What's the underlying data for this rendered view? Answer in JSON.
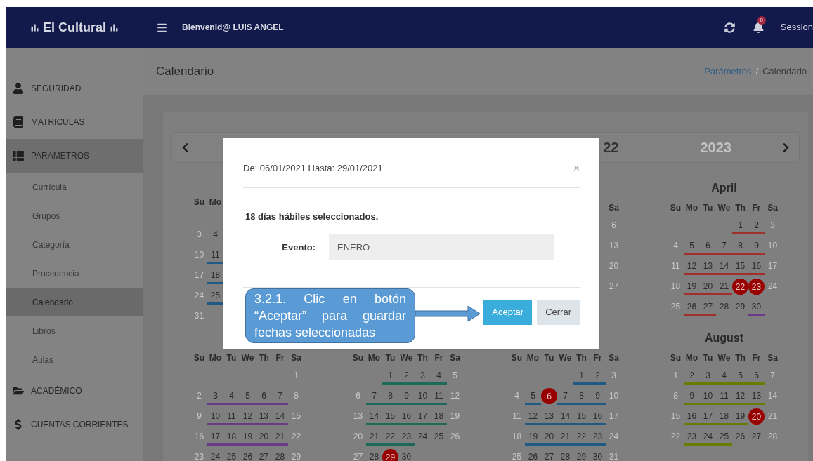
{
  "header": {
    "brand": "El Cultural",
    "welcome": "Bienvenid@ LUIS ANGEL",
    "notifications": "0",
    "session": "Session"
  },
  "sidebar": {
    "items": [
      {
        "label": "SEGURIDAD",
        "selected": false,
        "expanded": false
      },
      {
        "label": "MATRICULAS",
        "selected": false,
        "expanded": false
      },
      {
        "label": "PARAMETROS",
        "selected": false,
        "expanded": true,
        "children": [
          {
            "label": "Currícula",
            "selected": false
          },
          {
            "label": "Grupos",
            "selected": false
          },
          {
            "label": "Categoría",
            "selected": false
          },
          {
            "label": "Procedencia",
            "selected": false
          },
          {
            "label": "Calendario",
            "selected": true
          },
          {
            "label": "Libros",
            "selected": false
          },
          {
            "label": "Aulas",
            "selected": false
          }
        ]
      },
      {
        "label": "ACADÉMICO",
        "selected": false,
        "expanded": false
      },
      {
        "label": "CUENTAS CORRIENTES",
        "selected": false,
        "expanded": false
      }
    ]
  },
  "page": {
    "title": "Calendario",
    "separator": "/",
    "breadcrumb": [
      {
        "label": "Parámetros",
        "kind": "link"
      },
      {
        "label": "Calendario",
        "kind": "current"
      }
    ]
  },
  "calendar": {
    "years": [
      {
        "label": "22",
        "selected": true
      },
      {
        "label": "2023",
        "selected": false
      }
    ],
    "months": [
      {
        "kind": "left",
        "weekdays": [
          "Su",
          "Mo"
        ],
        "weeks": [
          {
            "kind": "covered"
          },
          {
            "kind": "days",
            "days": [
              {
                "d": "3",
                "kind": "plain"
              },
              {
                "d": "4",
                "kind": "plain"
              }
            ]
          },
          {
            "kind": "days",
            "days": [
              {
                "d": "10",
                "kind": "plain"
              },
              {
                "d": "11",
                "kind": "event",
                "color": "#1f5a85"
              }
            ]
          },
          {
            "kind": "days",
            "days": [
              {
                "d": "17",
                "kind": "plain"
              },
              {
                "d": "18",
                "kind": "event",
                "color": "#1f5a85"
              }
            ]
          },
          {
            "kind": "days",
            "days": [
              {
                "d": "24",
                "kind": "plain"
              },
              {
                "d": "25",
                "kind": "event",
                "color": "#1f5a85"
              }
            ]
          },
          {
            "kind": "days",
            "days": [
              {
                "d": "31",
                "kind": "plain"
              }
            ]
          }
        ]
      },
      {
        "kind": "covered"
      },
      {
        "kind": "right",
        "weekdays": [
          "Sa"
        ],
        "weeks": [
          {
            "kind": "days",
            "days": [
              {
                "d": "6",
                "kind": "plain"
              }
            ]
          },
          {
            "kind": "days",
            "days": [
              {
                "d": "13",
                "kind": "plain"
              }
            ]
          },
          {
            "kind": "days",
            "days": [
              {
                "d": "20",
                "kind": "plain"
              }
            ]
          },
          {
            "kind": "days",
            "days": [
              {
                "d": "27",
                "kind": "plain"
              }
            ]
          }
        ]
      },
      {
        "kind": "full",
        "title": "April",
        "weekdays": [
          "Su",
          "Mo",
          "Tu",
          "We",
          "Th",
          "Fr",
          "Sa"
        ],
        "weeks": [
          {
            "kind": "days",
            "days": [
              {
                "d": "1",
                "kind": "event",
                "color": "#a0302a"
              },
              {
                "d": "2",
                "kind": "event",
                "color": "#a0302a"
              },
              {
                "d": "3",
                "kind": "plain"
              }
            ]
          },
          {
            "kind": "days",
            "days": [
              {
                "d": "4",
                "kind": "plain"
              },
              {
                "d": "5",
                "kind": "event",
                "color": "#a0302a"
              },
              {
                "d": "6",
                "kind": "event",
                "color": "#a0302a"
              },
              {
                "d": "7",
                "kind": "event",
                "color": "#a0302a"
              },
              {
                "d": "8",
                "kind": "event",
                "color": "#a0302a"
              },
              {
                "d": "9",
                "kind": "event",
                "color": "#a0302a"
              },
              {
                "d": "10",
                "kind": "plain"
              }
            ]
          },
          {
            "kind": "days",
            "days": [
              {
                "d": "11",
                "kind": "plain"
              },
              {
                "d": "12",
                "kind": "event",
                "color": "#a0302a"
              },
              {
                "d": "13",
                "kind": "event",
                "color": "#a0302a"
              },
              {
                "d": "14",
                "kind": "event",
                "color": "#a0302a"
              },
              {
                "d": "15",
                "kind": "event",
                "color": "#a0302a"
              },
              {
                "d": "16",
                "kind": "event",
                "color": "#a0302a"
              },
              {
                "d": "17",
                "kind": "plain"
              }
            ]
          },
          {
            "kind": "days",
            "days": [
              {
                "d": "18",
                "kind": "plain"
              },
              {
                "d": "19",
                "kind": "event",
                "color": "#a0302a"
              },
              {
                "d": "20",
                "kind": "event",
                "color": "#a0302a"
              },
              {
                "d": "21",
                "kind": "event",
                "color": "#a0302a"
              },
              {
                "d": "22",
                "kind": "holiday"
              },
              {
                "d": "23",
                "kind": "holiday"
              },
              {
                "d": "24",
                "kind": "plain"
              }
            ]
          },
          {
            "kind": "days",
            "days": [
              {
                "d": "25",
                "kind": "plain"
              },
              {
                "d": "26",
                "kind": "event",
                "color": "#a0302a"
              },
              {
                "d": "27",
                "kind": "event",
                "color": "#a0302a"
              },
              {
                "d": "28",
                "kind": "plain"
              },
              {
                "d": "29",
                "kind": "plain"
              },
              {
                "d": "30",
                "kind": "event",
                "color": "#6a3a8a"
              }
            ]
          }
        ]
      },
      {
        "kind": "full",
        "weekdays": [
          "Su",
          "Mo",
          "Tu",
          "We",
          "Th",
          "Fr",
          "Sa"
        ],
        "weeks": [
          {
            "kind": "days",
            "days": [
              {
                "d": "1",
                "kind": "plain"
              }
            ]
          },
          {
            "kind": "days",
            "days": [
              {
                "d": "2",
                "kind": "plain"
              },
              {
                "d": "3",
                "kind": "event",
                "color": "#6a3a8a"
              },
              {
                "d": "4",
                "kind": "event",
                "color": "#6a3a8a"
              },
              {
                "d": "5",
                "kind": "event",
                "color": "#6a3a8a"
              },
              {
                "d": "6",
                "kind": "event",
                "color": "#6a3a8a"
              },
              {
                "d": "7",
                "kind": "event",
                "color": "#6a3a8a"
              },
              {
                "d": "8",
                "kind": "plain"
              }
            ]
          },
          {
            "kind": "days",
            "days": [
              {
                "d": "9",
                "kind": "plain"
              },
              {
                "d": "10",
                "kind": "event",
                "color": "#6a3a8a"
              },
              {
                "d": "11",
                "kind": "event",
                "color": "#6a3a8a"
              },
              {
                "d": "12",
                "kind": "event",
                "color": "#6a3a8a"
              },
              {
                "d": "13",
                "kind": "event",
                "color": "#6a3a8a"
              },
              {
                "d": "14",
                "kind": "event",
                "color": "#6a3a8a"
              },
              {
                "d": "15",
                "kind": "plain"
              }
            ]
          },
          {
            "kind": "days",
            "days": [
              {
                "d": "16",
                "kind": "plain"
              },
              {
                "d": "17",
                "kind": "event",
                "color": "#6a3a8a"
              },
              {
                "d": "18",
                "kind": "event",
                "color": "#6a3a8a"
              },
              {
                "d": "19",
                "kind": "event",
                "color": "#6a3a8a"
              },
              {
                "d": "20",
                "kind": "event",
                "color": "#6a3a8a"
              },
              {
                "d": "21",
                "kind": "event",
                "color": "#6a3a8a"
              },
              {
                "d": "22",
                "kind": "plain"
              }
            ]
          },
          {
            "kind": "days",
            "days": [
              {
                "d": "23",
                "kind": "plain"
              },
              {
                "d": "24",
                "kind": "plain"
              },
              {
                "d": "25",
                "kind": "plain"
              },
              {
                "d": "26",
                "kind": "plain"
              },
              {
                "d": "27",
                "kind": "plain"
              },
              {
                "d": "28",
                "kind": "plain"
              },
              {
                "d": "29",
                "kind": "plain"
              }
            ]
          }
        ]
      },
      {
        "kind": "full",
        "weekdays": [
          "Su",
          "Mo",
          "Tu",
          "We",
          "Th",
          "Fr",
          "Sa"
        ],
        "weeks": [
          {
            "kind": "days",
            "days": [
              {
                "d": "1",
                "kind": "event",
                "color": "#1e6a5a"
              },
              {
                "d": "2",
                "kind": "event",
                "color": "#1e6a5a"
              },
              {
                "d": "3",
                "kind": "event",
                "color": "#1e6a5a"
              },
              {
                "d": "4",
                "kind": "event",
                "color": "#1e6a5a"
              },
              {
                "d": "5",
                "kind": "plain"
              }
            ]
          },
          {
            "kind": "days",
            "days": [
              {
                "d": "6",
                "kind": "plain"
              },
              {
                "d": "7",
                "kind": "event",
                "color": "#1e6a5a"
              },
              {
                "d": "8",
                "kind": "event",
                "color": "#1e6a5a"
              },
              {
                "d": "9",
                "kind": "event",
                "color": "#1e6a5a"
              },
              {
                "d": "10",
                "kind": "event",
                "color": "#1e6a5a"
              },
              {
                "d": "11",
                "kind": "event",
                "color": "#1e6a5a"
              },
              {
                "d": "12",
                "kind": "plain"
              }
            ]
          },
          {
            "kind": "days",
            "days": [
              {
                "d": "13",
                "kind": "plain"
              },
              {
                "d": "14",
                "kind": "event",
                "color": "#1e6a5a"
              },
              {
                "d": "15",
                "kind": "event",
                "color": "#1e6a5a"
              },
              {
                "d": "16",
                "kind": "event",
                "color": "#1e6a5a"
              },
              {
                "d": "17",
                "kind": "event",
                "color": "#1e6a5a"
              },
              {
                "d": "18",
                "kind": "event",
                "color": "#1e6a5a"
              },
              {
                "d": "19",
                "kind": "plain"
              }
            ]
          },
          {
            "kind": "days",
            "days": [
              {
                "d": "20",
                "kind": "plain"
              },
              {
                "d": "21",
                "kind": "event",
                "color": "#1e6a5a"
              },
              {
                "d": "22",
                "kind": "event",
                "color": "#1e6a5a"
              },
              {
                "d": "23",
                "kind": "event",
                "color": "#1e6a5a"
              },
              {
                "d": "24",
                "kind": "plain"
              },
              {
                "d": "25",
                "kind": "plain"
              },
              {
                "d": "26",
                "kind": "plain"
              }
            ]
          },
          {
            "kind": "days",
            "days": [
              {
                "d": "27",
                "kind": "plain"
              },
              {
                "d": "28",
                "kind": "plain"
              },
              {
                "d": "29",
                "kind": "holiday"
              },
              {
                "d": "30",
                "kind": "plain"
              }
            ]
          }
        ]
      },
      {
        "kind": "full",
        "weekdays": [
          "Su",
          "Mo",
          "Tu",
          "We",
          "Th",
          "Fr",
          "Sa"
        ],
        "weeks": [
          {
            "kind": "days",
            "days": [
              {
                "d": "1",
                "kind": "event",
                "color": "#1f5a85"
              },
              {
                "d": "2",
                "kind": "event",
                "color": "#1f5a85"
              },
              {
                "d": "3",
                "kind": "plain"
              }
            ]
          },
          {
            "kind": "days",
            "days": [
              {
                "d": "4",
                "kind": "plain"
              },
              {
                "d": "5",
                "kind": "event",
                "color": "#1f5a85"
              },
              {
                "d": "6",
                "kind": "holiday"
              },
              {
                "d": "7",
                "kind": "event",
                "color": "#1f5a85"
              },
              {
                "d": "8",
                "kind": "event",
                "color": "#1f5a85"
              },
              {
                "d": "9",
                "kind": "event",
                "color": "#1f5a85"
              },
              {
                "d": "10",
                "kind": "plain"
              }
            ]
          },
          {
            "kind": "days",
            "days": [
              {
                "d": "11",
                "kind": "plain"
              },
              {
                "d": "12",
                "kind": "event",
                "color": "#1f5a85"
              },
              {
                "d": "13",
                "kind": "event",
                "color": "#1f5a85"
              },
              {
                "d": "14",
                "kind": "event",
                "color": "#1f5a85"
              },
              {
                "d": "15",
                "kind": "event",
                "color": "#1f5a85"
              },
              {
                "d": "16",
                "kind": "event",
                "color": "#1f5a85"
              },
              {
                "d": "17",
                "kind": "plain"
              }
            ]
          },
          {
            "kind": "days",
            "days": [
              {
                "d": "18",
                "kind": "plain"
              },
              {
                "d": "19",
                "kind": "event",
                "color": "#1f5a85"
              },
              {
                "d": "20",
                "kind": "event",
                "color": "#1f5a85"
              },
              {
                "d": "21",
                "kind": "event",
                "color": "#1f5a85"
              },
              {
                "d": "22",
                "kind": "event",
                "color": "#1f5a85"
              },
              {
                "d": "23",
                "kind": "event",
                "color": "#1f5a85"
              },
              {
                "d": "24",
                "kind": "plain"
              }
            ]
          },
          {
            "kind": "days",
            "days": [
              {
                "d": "25",
                "kind": "plain"
              },
              {
                "d": "26",
                "kind": "plain"
              },
              {
                "d": "27",
                "kind": "plain"
              },
              {
                "d": "28",
                "kind": "plain"
              },
              {
                "d": "29",
                "kind": "plain"
              },
              {
                "d": "30",
                "kind": "plain"
              },
              {
                "d": "31",
                "kind": "plain"
              }
            ]
          }
        ]
      },
      {
        "kind": "full",
        "title": "August",
        "weekdays": [
          "Su",
          "Mo",
          "Tu",
          "We",
          "Th",
          "Fr",
          "Sa"
        ],
        "weeks": [
          {
            "kind": "days",
            "days": [
              {
                "d": "1",
                "kind": "plain"
              },
              {
                "d": "2",
                "kind": "event",
                "color": "#6b7a00"
              },
              {
                "d": "3",
                "kind": "event",
                "color": "#6b7a00"
              },
              {
                "d": "4",
                "kind": "event",
                "color": "#6b7a00"
              },
              {
                "d": "5",
                "kind": "event",
                "color": "#6b7a00"
              },
              {
                "d": "6",
                "kind": "event",
                "color": "#6b7a00"
              },
              {
                "d": "7",
                "kind": "plain"
              }
            ]
          },
          {
            "kind": "days",
            "days": [
              {
                "d": "8",
                "kind": "plain"
              },
              {
                "d": "9",
                "kind": "event",
                "color": "#6b7a00"
              },
              {
                "d": "10",
                "kind": "event",
                "color": "#6b7a00"
              },
              {
                "d": "11",
                "kind": "event",
                "color": "#6b7a00"
              },
              {
                "d": "12",
                "kind": "event",
                "color": "#6b7a00"
              },
              {
                "d": "13",
                "kind": "event",
                "color": "#6b7a00"
              },
              {
                "d": "14",
                "kind": "plain"
              }
            ]
          },
          {
            "kind": "days",
            "days": [
              {
                "d": "15",
                "kind": "plain"
              },
              {
                "d": "16",
                "kind": "event",
                "color": "#6b7a00"
              },
              {
                "d": "17",
                "kind": "event",
                "color": "#6b7a00"
              },
              {
                "d": "18",
                "kind": "event",
                "color": "#6b7a00"
              },
              {
                "d": "19",
                "kind": "event",
                "color": "#6b7a00"
              },
              {
                "d": "20",
                "kind": "holiday"
              },
              {
                "d": "21",
                "kind": "plain"
              }
            ]
          },
          {
            "kind": "days",
            "days": [
              {
                "d": "22",
                "kind": "plain"
              },
              {
                "d": "23",
                "kind": "event",
                "color": "#6b7a00"
              },
              {
                "d": "24",
                "kind": "event",
                "color": "#6b7a00"
              },
              {
                "d": "25",
                "kind": "event",
                "color": "#6b7a00"
              },
              {
                "d": "26",
                "kind": "plain"
              },
              {
                "d": "27",
                "kind": "plain"
              },
              {
                "d": "28",
                "kind": "plain"
              }
            ]
          }
        ]
      }
    ]
  },
  "dialog": {
    "title": "De: 06/01/2021 Hasta: 29/01/2021",
    "close": "×",
    "message": "18 días hábiles seleccionados.",
    "event_label": "Evento:",
    "event_value": "ENERO",
    "buttons": [
      {
        "label": "Aceptar",
        "kind": "primary"
      },
      {
        "label": "Cerrar",
        "kind": "default"
      }
    ]
  },
  "callout": {
    "text": "3.2.1. Clic en botón “Aceptar” para guardar fechas seleccionadas"
  }
}
